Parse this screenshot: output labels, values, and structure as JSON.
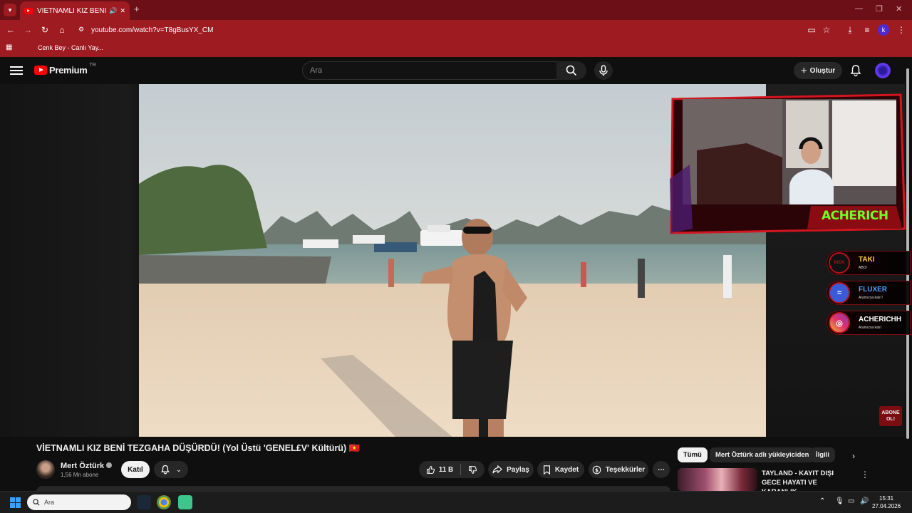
{
  "browser": {
    "tab_title": "VİETNAMLI KIZ BENİ TEZGA",
    "url": "youtube.com/watch?v=T8gBusYX_CM",
    "bookmark": "Cenk Bey - Canlı Yay...",
    "profile_initial": "k"
  },
  "youtube": {
    "logo_text": "Premium",
    "logo_region": "TR",
    "search_placeholder": "Ara",
    "create_label": "Oluştur"
  },
  "overlay": {
    "streamer_name": "ACHERICH",
    "socials": [
      {
        "badge": "KICK",
        "name": "TAKI",
        "sub": "ABO!"
      },
      {
        "badge": "≈",
        "name": "FLUXER",
        "sub": "Aramızsa katıl !"
      },
      {
        "badge": "◎",
        "name": "ACHERICHH",
        "sub": "Aramızsa katıl"
      }
    ],
    "abone_text": "ABONE OL!"
  },
  "video": {
    "title": "VİETNAMLI KIZ BENİ TEZGAHA DÜŞÜRDÜ! (Yol Üstü 'GENEL£V' Kültürü) 🇻🇳",
    "channel_name": "Mert Öztürk",
    "subscribers": "1,56 Mn abone",
    "join_label": "Katıl",
    "likes": "11 B",
    "share_label": "Paylaş",
    "save_label": "Kaydet",
    "thanks_label": "Teşekkürler"
  },
  "sidebar": {
    "chips": [
      "Tümü",
      "Mert Öztürk adlı yükleyiciden",
      "İlgili"
    ],
    "recommended_title": "TAYLAND - KAYIT DIŞI GECE HAYATI VE KARANLIK ..."
  },
  "taskbar": {
    "search_placeholder": "Ara",
    "time": "15:31",
    "date": "27.04.2026"
  }
}
